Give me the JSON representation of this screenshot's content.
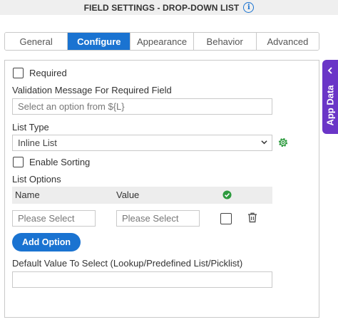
{
  "header": {
    "title": "FIELD SETTINGS - DROP-DOWN LIST",
    "info_icon": "info-icon",
    "background": "#efefef"
  },
  "tabs": [
    {
      "label": "General",
      "active": false
    },
    {
      "label": "Configure",
      "active": true
    },
    {
      "label": "Appearance",
      "active": false
    },
    {
      "label": "Behavior",
      "active": false
    },
    {
      "label": "Advanced",
      "active": false
    }
  ],
  "form": {
    "required": {
      "label": "Required",
      "checked": false
    },
    "validation_message": {
      "label": "Validation Message For Required Field",
      "value": "Select an option from ${L}"
    },
    "list_type": {
      "label": "List Type",
      "selected": "Inline List",
      "settings_icon": "gear-icon"
    },
    "enable_sorting": {
      "label": "Enable Sorting",
      "checked": false
    },
    "list_options": {
      "label": "List Options",
      "columns": {
        "name": "Name",
        "value": "Value",
        "default_icon": "check-circle-icon"
      },
      "rows": [
        {
          "name_placeholder": "Please Select",
          "value_placeholder": "Please Select",
          "default_checked": false,
          "delete_icon": "trash-icon"
        }
      ],
      "add_option_label": "Add Option"
    },
    "default_value": {
      "label": "Default Value To Select (Lookup/Predefined List/Picklist)",
      "value": ""
    }
  },
  "side_tab": {
    "label": "App Data",
    "icon": "chevron-left-icon",
    "color": "#6a35c7"
  },
  "colors": {
    "accent": "#1a73d1",
    "success": "#2e9b3f",
    "border": "#c9c9c9"
  }
}
